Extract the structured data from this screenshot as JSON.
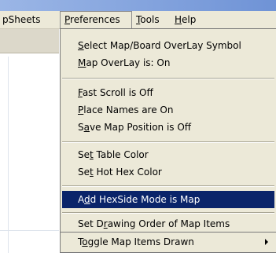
{
  "menubar": {
    "items": [
      {
        "pre": "pSheets",
        "mn": "",
        "post": ""
      },
      {
        "pre": "",
        "mn": "P",
        "post": "references"
      },
      {
        "pre": "",
        "mn": "T",
        "post": "ools"
      },
      {
        "pre": "",
        "mn": "H",
        "post": "elp"
      }
    ]
  },
  "menu": {
    "items": [
      {
        "pre": "",
        "mn": "S",
        "post": "elect Map/Board OverLay Symbol"
      },
      {
        "pre": "",
        "mn": "M",
        "post": "ap OverLay is: On"
      },
      {
        "pre": "",
        "mn": "F",
        "post": "ast Scroll is Off"
      },
      {
        "pre": "",
        "mn": "P",
        "post": "lace Names are On"
      },
      {
        "pre": "S",
        "mn": "a",
        "post": "ve Map Position is Off"
      },
      {
        "pre": "Se",
        "mn": "t",
        "post": " Table Color"
      },
      {
        "pre": "Se",
        "mn": "t",
        "post": " Hot Hex Color"
      },
      {
        "pre": "A",
        "mn": "d",
        "post": "d HexSide Mode is Map"
      },
      {
        "pre": "Set D",
        "mn": "r",
        "post": "awing Order of Map Items"
      },
      {
        "pre": "T",
        "mn": "o",
        "post": "ggle Map Items Drawn"
      }
    ]
  }
}
